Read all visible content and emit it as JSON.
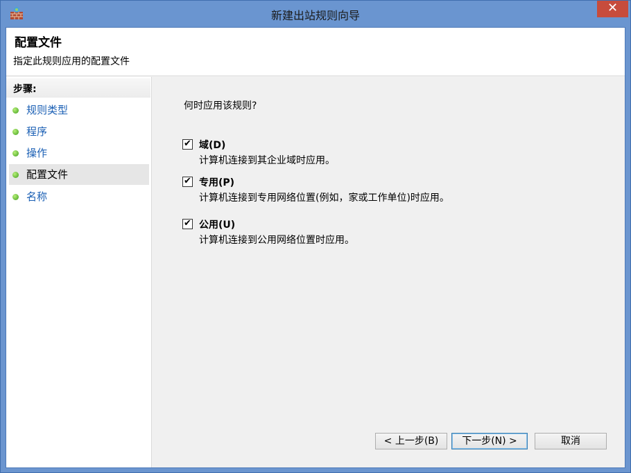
{
  "window": {
    "title": "新建出站规则向导",
    "close_glyph": "✕"
  },
  "header": {
    "title": "配置文件",
    "description": "指定此规则应用的配置文件"
  },
  "sidebar": {
    "heading": "步骤:",
    "steps": [
      {
        "label": "规则类型",
        "current": false
      },
      {
        "label": "程序",
        "current": false
      },
      {
        "label": "操作",
        "current": false
      },
      {
        "label": "配置文件",
        "current": true
      },
      {
        "label": "名称",
        "current": false
      }
    ]
  },
  "content": {
    "question": "何时应用该规则?",
    "options": [
      {
        "label": "域(D)",
        "description": "计算机连接到其企业域时应用。",
        "checked": true
      },
      {
        "label": "专用(P)",
        "description": "计算机连接到专用网络位置(例如，家或工作单位)时应用。",
        "checked": true
      },
      {
        "label": "公用(U)",
        "description": "计算机连接到公用网络位置时应用。",
        "checked": true
      }
    ],
    "check_glyph": "✔"
  },
  "buttons": {
    "back": "< 上一步(B)",
    "next": "下一步(N) >",
    "cancel": "取消"
  },
  "colors": {
    "titlebar": "#6a95d0",
    "close": "#c74c3c",
    "link": "#1a5fb4",
    "step_dot": "#3f9e1c"
  }
}
